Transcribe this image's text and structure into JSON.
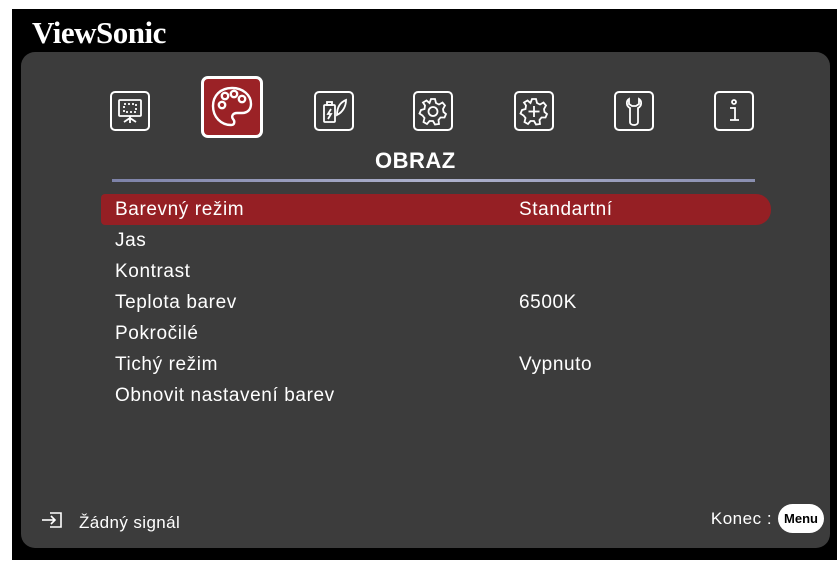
{
  "brand": "ViewSonic",
  "tabs": [
    {
      "name": "display-icon",
      "active": false
    },
    {
      "name": "palette-icon",
      "active": true
    },
    {
      "name": "power-eco-icon",
      "active": false
    },
    {
      "name": "gear-icon",
      "active": false
    },
    {
      "name": "advanced-gear-icon",
      "active": false
    },
    {
      "name": "wrench-icon",
      "active": false
    },
    {
      "name": "info-icon",
      "active": false
    }
  ],
  "section_title": "OBRAZ",
  "menu": [
    {
      "label": "Barevný režim",
      "value": "Standartní",
      "selected": true
    },
    {
      "label": "Jas",
      "value": ""
    },
    {
      "label": "Kontrast",
      "value": ""
    },
    {
      "label": "Teplota barev",
      "value": "6500K"
    },
    {
      "label": "Pokročilé",
      "value": ""
    },
    {
      "label": "Tichý režim",
      "value": "Vypnuto"
    },
    {
      "label": "Obnovit nastavení barev",
      "value": ""
    }
  ],
  "footer": {
    "signal_icon": "input-source-icon",
    "signal_text": "Žádný signál",
    "exit_label": "Konec :",
    "menu_button": "Menu"
  },
  "colors": {
    "highlight": "#951f24",
    "panel": "#3c3c3c",
    "background": "#000000"
  }
}
